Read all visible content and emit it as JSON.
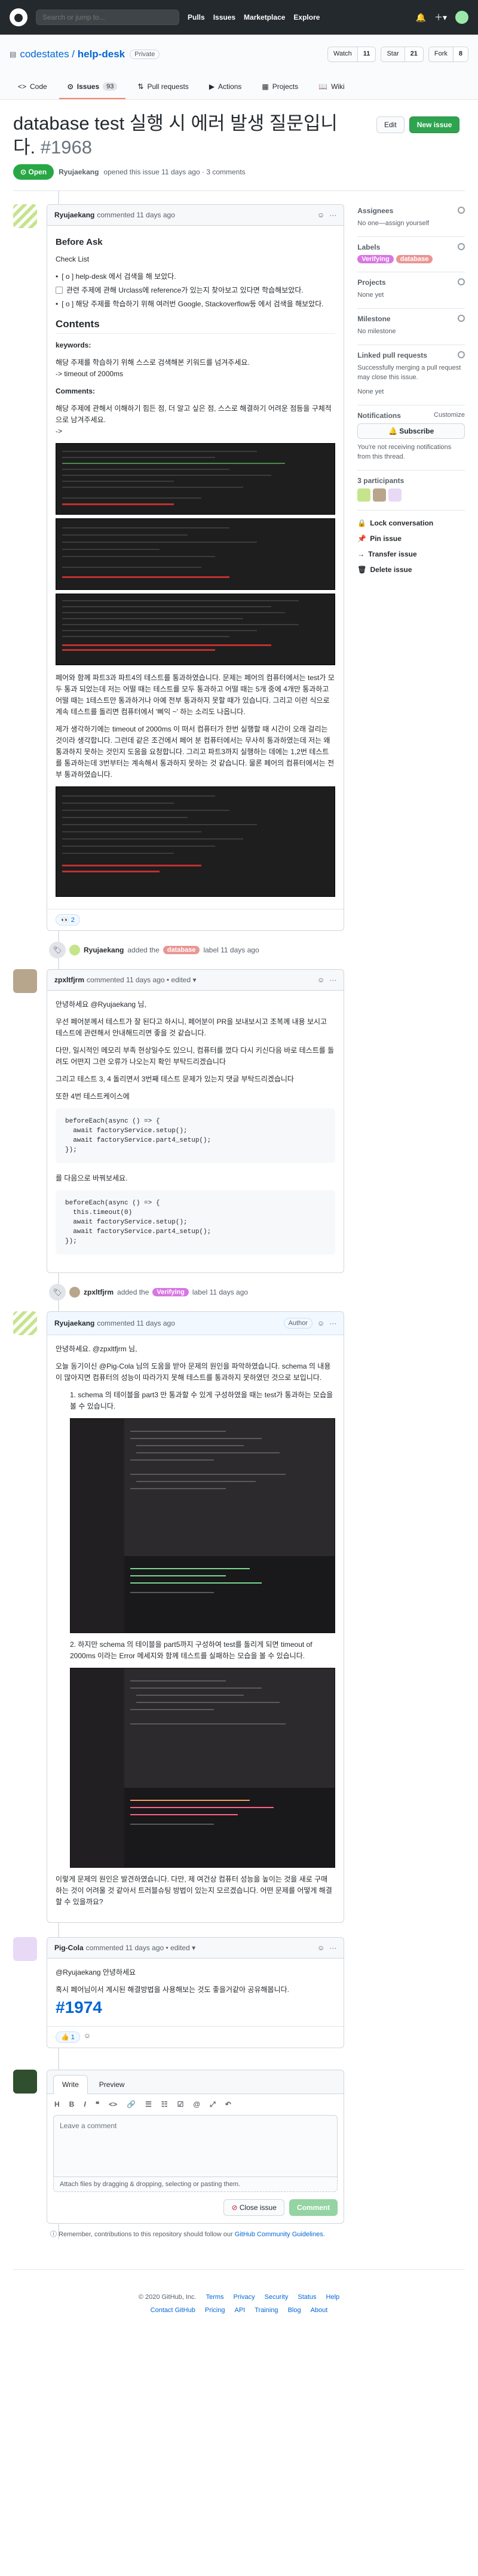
{
  "header": {
    "search_placeholder": "Search or jump to...",
    "nav": [
      "Pulls",
      "Issues",
      "Marketplace",
      "Explore"
    ]
  },
  "repo": {
    "owner": "codestates",
    "name": "help-desk",
    "visibility": "Private",
    "watch_label": "Watch",
    "watch_count": "11",
    "star_label": "Star",
    "star_count": "21",
    "fork_label": "Fork",
    "fork_count": "8"
  },
  "tabs": [
    {
      "label": "Code"
    },
    {
      "label": "Issues",
      "count": "93"
    },
    {
      "label": "Pull requests"
    },
    {
      "label": "Actions"
    },
    {
      "label": "Projects"
    },
    {
      "label": "Wiki"
    }
  ],
  "issue": {
    "title": "database test 실행 시 에러 발생 질문입니다.",
    "number": "#1968",
    "state": "Open",
    "author": "Ryujaekang",
    "opened_text": "opened this issue 11 days ago · 3 comments",
    "edit_label": "Edit",
    "new_label": "New issue"
  },
  "comment1": {
    "author": "Ryujaekang",
    "time": "commented 11 days ago",
    "h_before": "Before Ask",
    "checklist_title": "Check List",
    "checklist": [
      "[ o ] help-desk 에서 검색을 해 보았다.",
      "관련 주제에 관해 Urclass에 reference가 있는지 찾아보고 있다면 학습해보았다.",
      "[ o ] 해당 주제를 학습하기 위해 여러번 Google, Stackoverflow등 에서 검색을 해보았다."
    ],
    "h_contents": "Contents",
    "keywords_label": "keywords:",
    "keywords_text": "해당 주제를 학습하기 위해 스스로 검색해본 키워드를 넘겨주세요.",
    "keywords_val": "-> timeout of 2000ms",
    "comments_label": "Comments:",
    "comments_text": "해당 주제에 관해서 이해하기 힘든 점, 더 알고 싶은 점, 스스로 해결하기 어려운 점등을 구체적으로 남겨주세요.",
    "arrow": "->",
    "para1": "페어와 함께 파트3과 파트4의 테스트를 통과하였습니다. 문제는 페어의 컴퓨터에서는 test가 모두 통과 되었는데 저는 어떨 때는 테스트를 모두 통과하고 어떨 때는 5개 중에 4개만 통과하고 어떨 때는 1테스트만 통과하거나 아예 전부 통과하지 못할 때가 있습니다. 그리고 이런 식으로 계속 테스트를 돌리면 컴퓨터에서 '삐익 ~' 하는 소리도 나옵니다.",
    "para2": "제가 생각하기에는 timeout of 2000ms 이 떠서 컴퓨터가 한번 실행할 때 시간이 오래 걸리는 것이라 생각합니다. 그런데 같은 조건에서 페어 분 컴퓨터에서는 무사히 통과하였는데 저는 왜 통과하지 못하는 것인지 도움을 요청합니다. 그리고 파트3까지 실행하는 데에는 1,2번 테스트를 통과하는데 3번부터는 계속해서 통과하지 못하는 것 같습니다. 물론 페어의 컴퓨터에서는 전부 통과하였습니다.",
    "reaction_emoji": "👀",
    "reaction_count": "2"
  },
  "event1": {
    "actor": "Ryujaekang",
    "text_before": "added the",
    "label": "database",
    "text_after": "label 11 days ago"
  },
  "comment2": {
    "author": "zpxltfjrm",
    "time": "commented 11 days ago",
    "edited": "• edited ▾",
    "p1": "안녕하세요 @Ryujaekang 님,",
    "p2": "우선 페어분께서 테스트가 잘 된다고 하시니, 페어분이 PR을 보내보시고 조복께 내용 보시고 테스트에 관련해서 안내해드리면 좋을 것 같습니다.",
    "p3": "다만, 일시적인 메모리 부족 현상일수도 있으니, 컴퓨터를 껐다 다시 키신다음 바로 테스트를 돌려도 어떤지 그런 오류가 나오는지 확인 부탁드리겠습니다",
    "p4": "그리고 테스트 3, 4 돌리면서 3번째 테스트 문제가 있는지 댓글 부탁드리겠습니다",
    "p5": "또한 4번 테스트케이스에",
    "code1": [
      "beforeEach(async () => {",
      "  await factoryService.setup();",
      "  await factoryService.part4_setup();",
      "});"
    ],
    "p6": "를 다음으로 바꿔보세요.",
    "code2": [
      "beforeEach(async () => {",
      "  this.timeout(0)",
      "  await factoryService.setup();",
      "  await factoryService.part4_setup();",
      "});"
    ]
  },
  "event2": {
    "actor": "zpxltfjrm",
    "text_before": "added the",
    "label": "Verifying",
    "text_after": "label 11 days ago"
  },
  "comment3": {
    "author": "Ryujaekang",
    "time": "commented 11 days ago",
    "author_tag": "Author",
    "p1": "안녕하세요. @zpxltfjrm 님,",
    "p2": "오늘 동기이신 @Pig-Cola 님의 도움을 받아 문제의 원인을 파악하였습니다. schema 의 내용이 많아지면 컴퓨터의 성능이 따라가지 못해 테스트를 통과하지 못하였던 것으로 보입니다.",
    "item1": "1. schema 의 테이블을 part3 만 통과할 수 있게 구성하였을 때는 test가 통과하는 모습을 볼 수 있습니다.",
    "item2": "2. 하지만 schema 의 테이블을 part5까지 구성하여 test를 돌리게 되면 timeout of 2000ms 이라는 Error 메세지와 함께 테스트를 실패하는 모습을 볼 수 있습니다.",
    "p3": "이렇게 문제의 원인은 발견하였습니다. 다만, 제 여건상 컴퓨터 성능을 높이는 것을 새로 구매 하는 것이 어려울 것 같아서 트러블슈팅 방법이 있는지 모르겠습니다. 어떤 문제를 어떻게 해결할 수 있을까요?"
  },
  "comment4": {
    "author": "Pig-Cola",
    "time": "commented 11 days ago",
    "edited": "• edited ▾",
    "p1": "@Ryujaekang 안녕하세요",
    "p2": "혹시 페어님이서 계시된 해결방법을 사용해보는 것도 좋을거같아 공유해봅니다.",
    "ref": "#1974",
    "reaction_emoji": "👍",
    "reaction_count": "1"
  },
  "editor": {
    "tab_write": "Write",
    "tab_preview": "Preview",
    "tools": [
      "H",
      "B",
      "I",
      "❝",
      "<>",
      "🔗",
      "☰",
      "☷",
      "☑",
      "@",
      "⤢",
      "↶"
    ],
    "placeholder": "Leave a comment",
    "attach": "Attach files by dragging & dropping, selecting or pasting them.",
    "close_label": "Close issue",
    "comment_label": "Comment"
  },
  "remember": {
    "prefix": "Remember, contributions to this repository should follow our",
    "link": "GitHub Community Guidelines",
    "suffix": "."
  },
  "sidebar": {
    "assignees": "Assignees",
    "assignees_val": "No one—assign yourself",
    "labels": "Labels",
    "labels_list": [
      {
        "name": "Verifying",
        "color": "#d876e3"
      },
      {
        "name": "database",
        "color": "#e99695"
      }
    ],
    "projects": "Projects",
    "projects_val": "None yet",
    "milestone": "Milestone",
    "milestone_val": "No milestone",
    "linked": "Linked pull requests",
    "linked_val": "Successfully merging a pull request may close this issue.",
    "linked_none": "None yet",
    "notifications": "Notifications",
    "customize": "Customize",
    "subscribe": "Subscribe",
    "notif_text": "You're not receiving notifications from this thread.",
    "participants": "3 participants",
    "actions": [
      "Lock conversation",
      "Pin issue",
      "Transfer issue",
      "Delete issue"
    ]
  },
  "footer": {
    "copyright": "© 2020 GitHub, Inc.",
    "links1": [
      "Terms",
      "Privacy",
      "Security",
      "Status",
      "Help"
    ],
    "links2": [
      "Contact GitHub",
      "Pricing",
      "API",
      "Training",
      "Blog",
      "About"
    ]
  }
}
